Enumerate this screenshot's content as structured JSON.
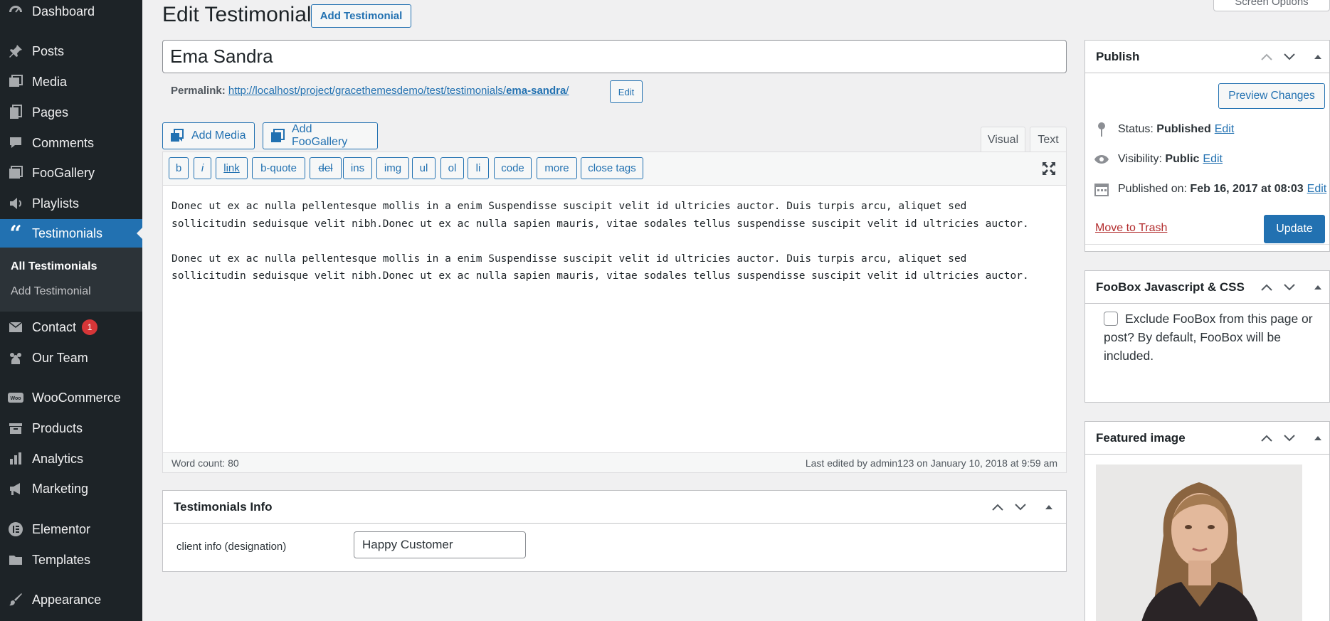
{
  "sidebar": {
    "items": [
      {
        "label": "Dashboard",
        "icon": "dashboard-icon"
      },
      {
        "label": "Posts",
        "icon": "pin-icon"
      },
      {
        "label": "Media",
        "icon": "media-icon"
      },
      {
        "label": "Pages",
        "icon": "pages-icon"
      },
      {
        "label": "Comments",
        "icon": "comments-icon"
      },
      {
        "label": "FooGallery",
        "icon": "gallery-icon"
      },
      {
        "label": "Playlists",
        "icon": "playlist-icon"
      },
      {
        "label": "Testimonials",
        "icon": "quote-icon"
      },
      {
        "label": "Contact",
        "icon": "mail-icon",
        "badge": "1"
      },
      {
        "label": "Our Team",
        "icon": "team-icon"
      },
      {
        "label": "WooCommerce",
        "icon": "woo-icon"
      },
      {
        "label": "Products",
        "icon": "archive-icon"
      },
      {
        "label": "Analytics",
        "icon": "chart-icon"
      },
      {
        "label": "Marketing",
        "icon": "megaphone-icon"
      },
      {
        "label": "Elementor",
        "icon": "elementor-icon"
      },
      {
        "label": "Templates",
        "icon": "folder-icon"
      },
      {
        "label": "Appearance",
        "icon": "brush-icon"
      }
    ],
    "submenu": [
      {
        "label": "All Testimonials"
      },
      {
        "label": "Add Testimonial"
      }
    ]
  },
  "header": {
    "title": "Edit Testimonial",
    "add_button": "Add Testimonial",
    "screen_options": "Screen Options"
  },
  "post": {
    "title": "Ema Sandra",
    "permalink_label": "Permalink:",
    "permalink_base": "http://localhost/project/gracethemesdemo/test/testimonials/",
    "permalink_slug": "ema-sandra",
    "permalink_tail": "/",
    "permalink_edit": "Edit"
  },
  "editor": {
    "add_media": "Add Media",
    "add_foogallery": "Add FooGallery",
    "tabs": [
      "Visual",
      "Text"
    ],
    "active_tab": "Text",
    "quicktags": [
      "b",
      "i",
      "link",
      "b-quote",
      "del",
      "ins",
      "img",
      "ul",
      "ol",
      "li",
      "code",
      "more",
      "close tags"
    ],
    "content": "Donec ut ex ac nulla pellentesque mollis in a enim Suspendisse suscipit velit id ultricies auctor. Duis turpis arcu, aliquet sed\nsollicitudin seduisque velit nibh.Donec ut ex ac nulla sapien mauris, vitae sodales tellus suspendisse suscipit velit id ultricies auctor.\n\nDonec ut ex ac nulla pellentesque mollis in a enim Suspendisse suscipit velit id ultricies auctor. Duis turpis arcu, aliquet sed\nsollicitudin seduisque velit nibh.Donec ut ex ac nulla sapien mauris, vitae sodales tellus suspendisse suscipit velit id ultricies auctor.",
    "word_count": "Word count: 80",
    "last_edited": "Last edited by admin123 on January 10, 2018 at 9:59 am"
  },
  "testimonials_info": {
    "title": "Testimonials Info",
    "field_label": "client info (designation)",
    "field_value": "Happy Customer"
  },
  "publish": {
    "title": "Publish",
    "preview": "Preview Changes",
    "status_label": "Status:",
    "status_value": "Published",
    "visibility_label": "Visibility:",
    "visibility_value": "Public",
    "published_label": "Published on:",
    "published_value": "Feb 16, 2017 at 08:03",
    "edit": "Edit",
    "trash": "Move to Trash",
    "update": "Update"
  },
  "foobox": {
    "title": "FooBox Javascript & CSS",
    "checkbox_label": "Exclude FooBox from this page or post? By default, FooBox will be included."
  },
  "featured": {
    "title": "Featured image"
  },
  "colors": {
    "sidebar_bg": "#1d2327",
    "accent": "#2271b1",
    "trash": "#b32d2e",
    "badge": "#d63638"
  }
}
